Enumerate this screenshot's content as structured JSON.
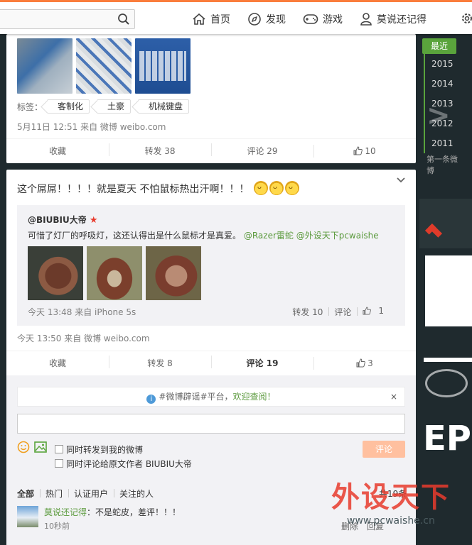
{
  "colors": {
    "accent": "#fa7d3c",
    "link": "#5b9a3d",
    "timeline": "#5aa43c",
    "send_button": "#ffc09f"
  },
  "topbar": {
    "search_placeholder": "",
    "nav": [
      {
        "icon": "home-icon",
        "label": "首页"
      },
      {
        "icon": "compass-icon",
        "label": "发现"
      },
      {
        "icon": "gamepad-icon",
        "label": "游戏"
      },
      {
        "icon": "user-icon",
        "label": "莫说还记得"
      }
    ]
  },
  "post1": {
    "tags_label": "标签：",
    "tags": [
      "客制化",
      "土豪",
      "机械键盘"
    ],
    "meta": "5月11日 12:51 来自 微博 weibo.com",
    "actions": {
      "fav": "收藏",
      "repost": "转发 38",
      "comment": "评论 29",
      "like": "10"
    }
  },
  "post2": {
    "text": "这个屌屌！！！！就是夏天 不怕鼠标热出汗啊！！！",
    "repost": {
      "author": "@BIUBIU大帝",
      "text_plain": "可惜了灯厂的呼吸灯，这还认得出是什么鼠标才是真爱。",
      "text_links": "@Razer雷蛇 @外设天下pcwaishe",
      "meta": "今天 13:48 来自 iPhone 5s",
      "repost": "转发 10",
      "comment": "评论",
      "like": "1"
    },
    "meta": "今天 13:50 来自 微博 weibo.com",
    "actions": {
      "fav": "收藏",
      "repost": "转发 8",
      "comment": "评论 19",
      "like": "3"
    }
  },
  "comments": {
    "notice_prefix": "#微博辟谣#平台，",
    "notice_link": "欢迎查阅！",
    "input_value": "",
    "option1": "同时转发到我的微博",
    "option2": "同时评论给原文作者 BIUBIU大帝",
    "send": "评论",
    "filters": [
      "全部",
      "热门",
      "认证用户",
      "关注的人"
    ],
    "count": "共19条",
    "first": {
      "name": "莫说还记得",
      "text": "：不是蛇皮，差评！！！",
      "time": "10秒前",
      "delete": "删除",
      "reply": "回复"
    }
  },
  "timeline": {
    "recent": "最近",
    "years": [
      "2015",
      "2014",
      "2013",
      "2012",
      "2011"
    ],
    "first": "第一条微博"
  },
  "watermark": {
    "logo": "外设天下",
    "site": "www.pcwaishe.cn"
  }
}
